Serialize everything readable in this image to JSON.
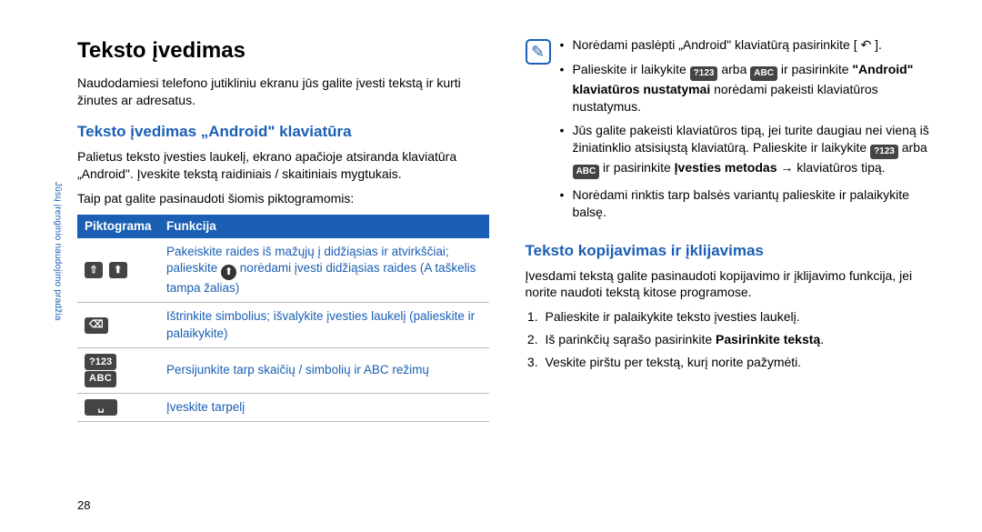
{
  "sideTab": "Jūsų įrenginio naudojimo pradžia",
  "pageNumber": "28",
  "left": {
    "h1": "Teksto įvedimas",
    "intro": "Naudodamiesi telefono jutikliniu ekranu jūs galite įvesti tekstą ir kurti žinutes ar adresatus.",
    "h2": "Teksto įvedimas „Android\" klaviatūra",
    "p1": "Palietus teksto įvesties laukelį, ekrano apačioje atsiranda klaviatūra „Android\". Įveskite tekstą raidiniais / skaitiniais mygtukais.",
    "p2": "Taip pat galite pasinaudoti šiomis piktogramomis:",
    "th1": "Piktograma",
    "th2": "Funkcija",
    "rows": [
      {
        "icons": "shift",
        "desc_a": "Pakeiskite raides iš mažųjų į didžiąsias ir atvirkščiai; palieskite ",
        "desc_b": " norėdami įvesti didžiąsias raides (A taškelis tampa žalias)"
      },
      {
        "icons": "back",
        "desc": "Ištrinkite simbolius; išvalykite įvesties laukelį (palieskite ir palaikykite)"
      },
      {
        "icons": "numabc",
        "desc": "Persijunkite tarp skaičių / simbolių ir ABC režimų"
      },
      {
        "icons": "space",
        "desc": "Įveskite tarpelį"
      }
    ]
  },
  "right": {
    "bullets": [
      {
        "a": "Norėdami paslėpti „Android\" klaviatūrą pasirinkite [ ",
        "b": " ]."
      },
      {
        "a": "Palieskite ir laikykite ",
        "b": " arba ",
        "c": " ir pasirinkite ",
        "bold1": "\"Android\" klaviatūros nustatymai",
        "d": " norėdami pakeisti klaviatūros nustatymus."
      },
      {
        "a": "Jūs galite pakeisti klaviatūros tipą, jei turite daugiau nei vieną iš žiniatinklio atsisiųstą klaviatūrą. Palieskite ir laikykite ",
        "b": " arba ",
        "c": " ir pasirinkite ",
        "bold1": "Įvesties metodas",
        "d": " → klaviatūros tipą."
      },
      {
        "a": "Norėdami rinktis tarp balsės variantų palieskite ir palaikykite balsę."
      }
    ],
    "h2": "Teksto kopijavimas ir įklijavimas",
    "p1": "Įvesdami tekstą galite pasinaudoti kopijavimo ir įklijavimo funkcija, jei norite naudoti tekstą kitose programose.",
    "ol": [
      "Palieskite ir palaikykite teksto įvesties laukelį.",
      {
        "a": "Iš parinkčių sąrašo pasirinkite ",
        "b": "Pasirinkite tekstą",
        "c": "."
      },
      "Veskite pirštu per tekstą, kurį norite pažymėti."
    ]
  }
}
